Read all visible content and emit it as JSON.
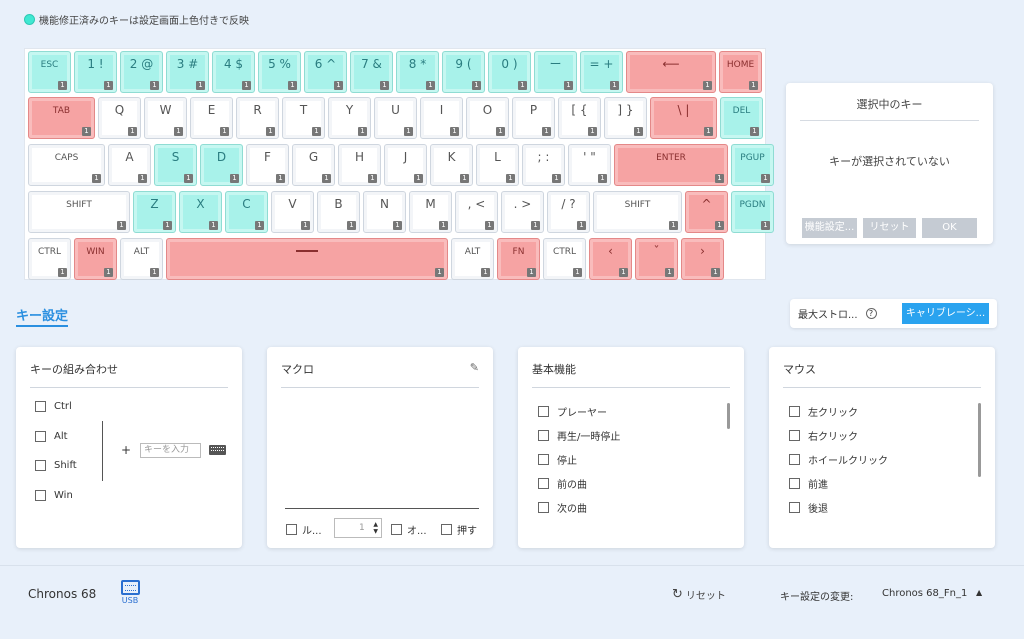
{
  "legend": {
    "text": "機能修正済みのキーは設定画面上色付きで反映",
    "color": "#3fe8d2"
  },
  "keyboard": {
    "colors": {
      "modified": "#a8f2ea",
      "fn_layer": "#f6a3a3"
    },
    "badge": "1",
    "rows": [
      [
        {
          "label": "ESC",
          "style": "cyan",
          "small": true
        },
        {
          "label": "1 !",
          "style": "cyan"
        },
        {
          "label": "2 @",
          "style": "cyan"
        },
        {
          "label": "3 #",
          "style": "cyan"
        },
        {
          "label": "4 $",
          "style": "cyan"
        },
        {
          "label": "5 %",
          "style": "cyan"
        },
        {
          "label": "6 ^",
          "style": "cyan"
        },
        {
          "label": "7 &",
          "style": "cyan"
        },
        {
          "label": "8 *",
          "style": "cyan"
        },
        {
          "label": "9 (",
          "style": "cyan"
        },
        {
          "label": "0 )",
          "style": "cyan"
        },
        {
          "label": "ー",
          "style": "cyan"
        },
        {
          "label": "= +",
          "style": "cyan"
        },
        {
          "label": "⟵",
          "style": "red",
          "icon": true
        },
        {
          "label": "HOME",
          "style": "red",
          "small": true
        }
      ],
      [
        {
          "label": "TAB",
          "style": "red",
          "small": true
        },
        {
          "label": "Q"
        },
        {
          "label": "W"
        },
        {
          "label": "E"
        },
        {
          "label": "R"
        },
        {
          "label": "T"
        },
        {
          "label": "Y"
        },
        {
          "label": "U"
        },
        {
          "label": "I"
        },
        {
          "label": "O"
        },
        {
          "label": "P"
        },
        {
          "label": "[ {"
        },
        {
          "label": "] }"
        },
        {
          "label": "\\ |",
          "style": "red"
        },
        {
          "label": "DEL",
          "style": "cyan",
          "small": true
        }
      ],
      [
        {
          "label": "CAPS",
          "small": true
        },
        {
          "label": "A"
        },
        {
          "label": "S",
          "style": "cyan"
        },
        {
          "label": "D",
          "style": "cyan"
        },
        {
          "label": "F"
        },
        {
          "label": "G"
        },
        {
          "label": "H"
        },
        {
          "label": "J"
        },
        {
          "label": "K"
        },
        {
          "label": "L"
        },
        {
          "label": "; :"
        },
        {
          "label": "' \""
        },
        {
          "label": "ENTER",
          "style": "red",
          "small": true
        },
        {
          "label": "PGUP",
          "style": "cyan",
          "small": true
        }
      ],
      [
        {
          "label": "SHIFT",
          "small": true
        },
        {
          "label": "Z",
          "style": "cyan"
        },
        {
          "label": "X",
          "style": "cyan"
        },
        {
          "label": "C",
          "style": "cyan"
        },
        {
          "label": "V"
        },
        {
          "label": "B"
        },
        {
          "label": "N"
        },
        {
          "label": "M"
        },
        {
          "label": ", <"
        },
        {
          "label": ". >"
        },
        {
          "label": "/ ?"
        },
        {
          "label": "SHIFT",
          "small": true
        },
        {
          "label": "^",
          "style": "red"
        },
        {
          "label": "PGDN",
          "style": "cyan",
          "small": true
        }
      ],
      [
        {
          "label": "CTRL",
          "small": true
        },
        {
          "label": "WIN",
          "style": "red",
          "small": true
        },
        {
          "label": "ALT",
          "small": true
        },
        {
          "label": "",
          "style": "red",
          "space": true
        },
        {
          "label": "ALT",
          "small": true
        },
        {
          "label": "FN",
          "style": "red",
          "small": true
        },
        {
          "label": "CTRL",
          "small": true
        },
        {
          "label": "‹",
          "style": "red"
        },
        {
          "label": "ˇ",
          "style": "red"
        },
        {
          "label": "›",
          "style": "red"
        }
      ]
    ]
  },
  "selection_panel": {
    "title": "選択中のキー",
    "message": "キーが選択されていない",
    "buttons": [
      "機能設定...",
      "リセット",
      "OK"
    ]
  },
  "key_settings": {
    "title": "キー設定"
  },
  "stroke": {
    "label": "最大ストロ...",
    "help": "?",
    "calibrate": "キャリブレーシ..."
  },
  "combo_card": {
    "title": "キーの組み合わせ",
    "modifiers": [
      "Ctrl",
      "Alt",
      "Shift",
      "Win"
    ],
    "plus": "+",
    "placeholder": "キーを入力"
  },
  "macro_card": {
    "title": "マクロ",
    "loop_label": "ル...",
    "count": "1",
    "other_label": "オ...",
    "press_label": "押す"
  },
  "basic_card": {
    "title": "基本機能",
    "items": [
      "プレーヤー",
      "再生/一時停止",
      "停止",
      "前の曲",
      "次の曲"
    ]
  },
  "mouse_card": {
    "title": "マウス",
    "items": [
      "左クリック",
      "右クリック",
      "ホイールクリック",
      "前進",
      "後退"
    ]
  },
  "footer": {
    "model": "Chronos 68",
    "connection": "USB",
    "reset": "リセット",
    "change_label": "キー設定の変更:",
    "profile": "Chronos 68_Fn_1"
  }
}
